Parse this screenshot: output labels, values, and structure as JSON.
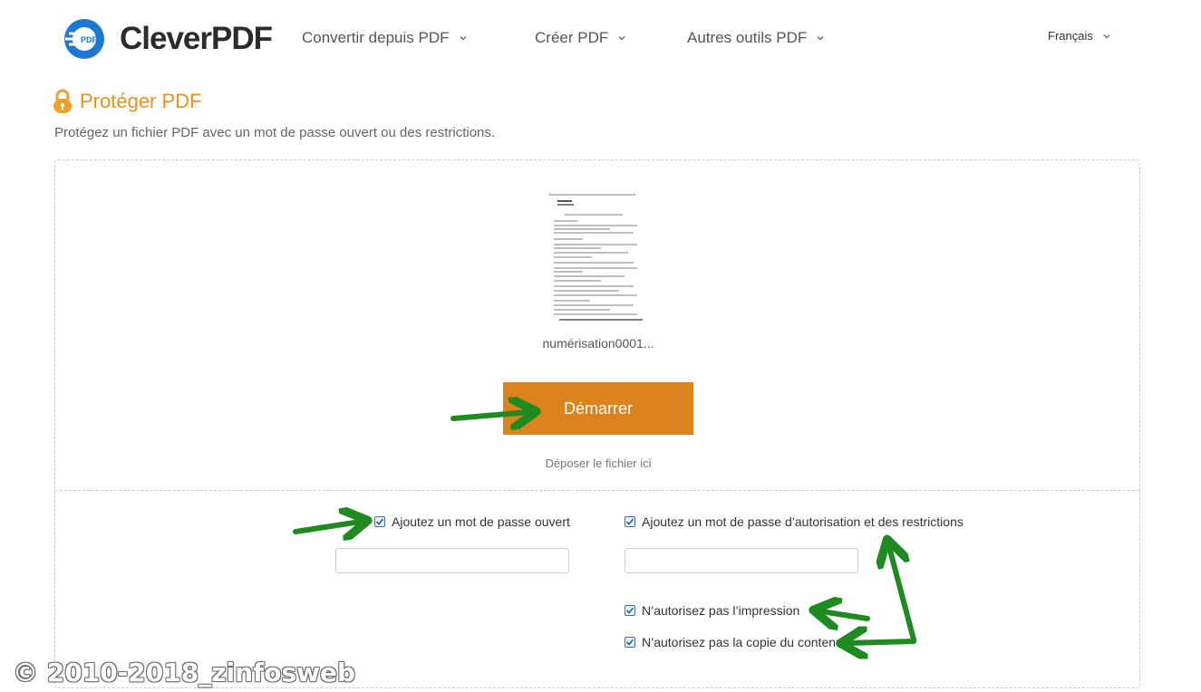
{
  "brand": {
    "name": "CleverPDF",
    "mark_text": "PDF",
    "color": "#1c78d3"
  },
  "nav": {
    "items": [
      {
        "label": "Convertir depuis PDF"
      },
      {
        "label": "Créer PDF"
      },
      {
        "label": "Autres outils PDF"
      }
    ],
    "language": "Français"
  },
  "page": {
    "title": "Protéger PDF",
    "subtitle": "Protégez un fichier PDF avec un mot de passe ouvert ou des restrictions.",
    "accent": "#e8911f"
  },
  "upload": {
    "filename": "numérisation0001...",
    "start_label": "Démarrer",
    "start_color": "#db841e",
    "drop_hint": "Déposer le fichier ici"
  },
  "options": {
    "open_password": {
      "label": "Ajoutez un mot de passe ouvert",
      "checked": true,
      "value": ""
    },
    "permission_password": {
      "label": "Ajoutez un mot de passe d’autorisation et des restrictions",
      "checked": true,
      "value": ""
    },
    "no_print": {
      "label": "N’autorisez pas l’impression",
      "checked": true
    },
    "no_copy": {
      "label": "N’autorisez pas la copie du contenu",
      "checked": true
    }
  },
  "watermark": "© 2010-2018_zinfosweb"
}
